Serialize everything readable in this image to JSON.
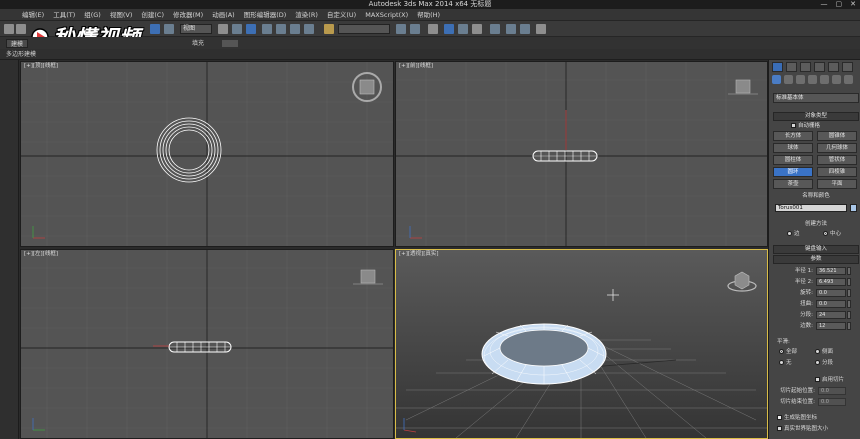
{
  "window": {
    "title": "Autodesk 3ds Max  2014 x64      无标题",
    "controls": [
      "—",
      "▢",
      "✕"
    ]
  },
  "watermark": "秒懂视频",
  "menu": [
    "编辑(E)",
    "工具(T)",
    "组(G)",
    "视图(V)",
    "创建(C)",
    "修改器(M)",
    "动画(A)",
    "图形编辑器(D)",
    "渲染(R)",
    "自定义(U)",
    "MAXScript(X)",
    "帮助(H)"
  ],
  "toolbar": {
    "view_select": "视图",
    "selection_set": ""
  },
  "ribbon": {
    "tabs": [
      "建模",
      "填充"
    ],
    "sub_label": "多边形建模"
  },
  "viewports": {
    "top": "[+][顶][线框]",
    "front": "[+][前][线框]",
    "left": "[+][左][线框]",
    "perspective": "[+][透视][真实]"
  },
  "command_panel": {
    "dropdown": "标准基本体",
    "object_type": {
      "title": "对象类型",
      "auto_grid": "自动栅格",
      "buttons": [
        "长方体",
        "圆锥体",
        "球体",
        "几何球体",
        "圆柱体",
        "管状体",
        "圆环",
        "四棱锥",
        "茶壶",
        "平面"
      ],
      "selected": "圆环"
    },
    "name_color": {
      "title": "名称和颜色",
      "name": "Torus001",
      "color": "#a9c7e8"
    },
    "creation_method": {
      "title": "创建方法",
      "options": [
        "边",
        "中心"
      ],
      "selected": "中心"
    },
    "keyboard_entry": "键盘输入",
    "parameters": {
      "title": "参数",
      "fields": [
        {
          "label": "半径 1:",
          "value": "36.521"
        },
        {
          "label": "半径 2:",
          "value": "6.493"
        },
        {
          "label": "旋转:",
          "value": "0.0"
        },
        {
          "label": "扭曲:",
          "value": "0.0"
        },
        {
          "label": "分段:",
          "value": "24"
        },
        {
          "label": "边数:",
          "value": "12"
        }
      ],
      "smooth_title": "平滑:",
      "smooth_options": [
        "全部",
        "侧面",
        "无",
        "分段"
      ],
      "smooth_selected": "全部",
      "slice_on": "启用切片",
      "slice_from_label": "切片起始位置:",
      "slice_from": "0.0",
      "slice_to_label": "切片结束位置:",
      "slice_to": "0.0",
      "gen_mapping": "生成贴图坐标",
      "real_world": "真实世界贴图大小"
    }
  }
}
